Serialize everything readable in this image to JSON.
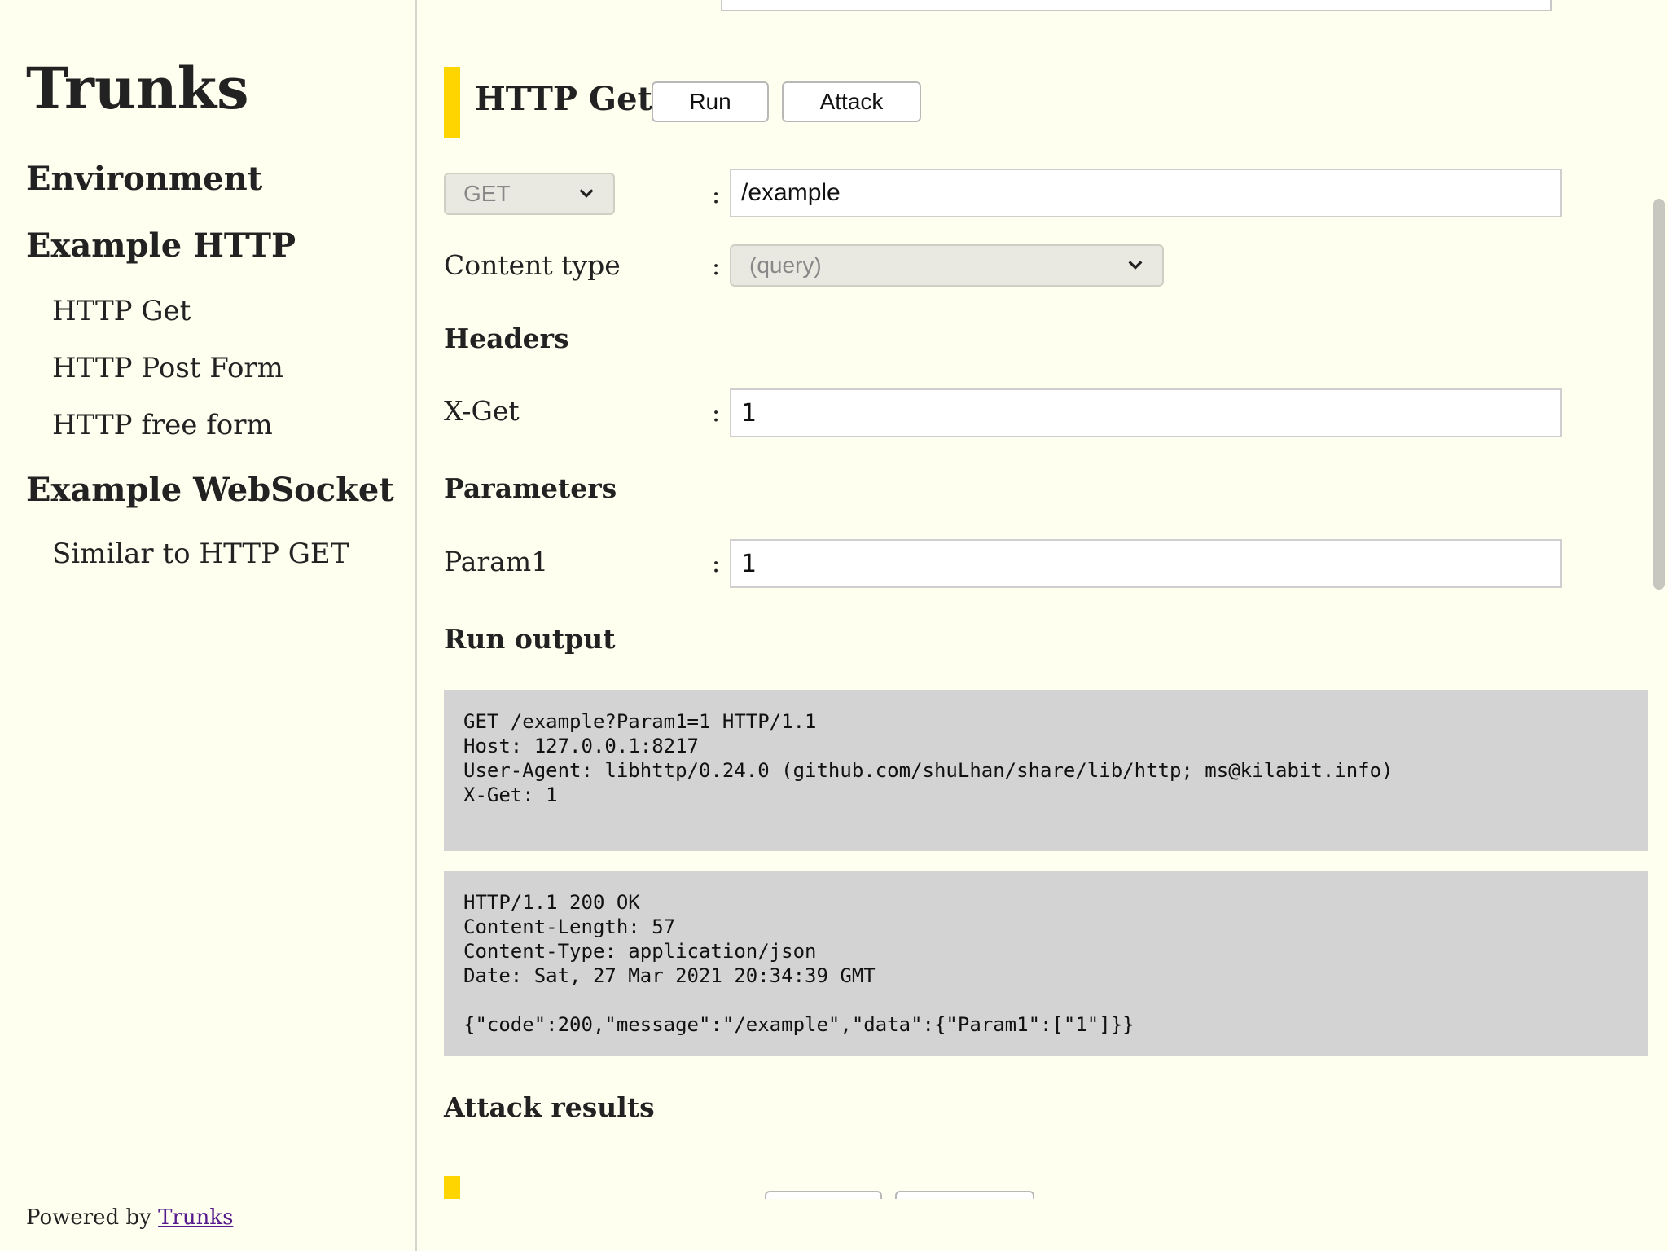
{
  "sidebar": {
    "brand": "Trunks",
    "environment": "Environment",
    "group_http": "Example HTTP",
    "http_items": [
      "HTTP Get",
      "HTTP Post Form",
      "HTTP free form"
    ],
    "group_ws": "Example WebSocket",
    "ws_items": [
      "Similar to HTTP GET"
    ]
  },
  "footer": {
    "prefix": "Powered by ",
    "link": "Trunks"
  },
  "request": {
    "title": "HTTP Get",
    "run_label": "Run",
    "attack_label": "Attack",
    "method": "GET",
    "path": "/example",
    "content_type_label": "Content type",
    "content_type_value": "(query)",
    "colon": ":"
  },
  "headers": {
    "heading": "Headers",
    "items": [
      {
        "key": "X-Get",
        "value": "1"
      }
    ]
  },
  "parameters": {
    "heading": "Parameters",
    "items": [
      {
        "key": "Param1",
        "value": "1"
      }
    ]
  },
  "run_output": {
    "heading": "Run output",
    "request_dump": "GET /example?Param1=1 HTTP/1.1\nHost: 127.0.0.1:8217\nUser-Agent: libhttp/0.24.0 (github.com/shuLhan/share/lib/http; ms@kilabit.info)\nX-Get: 1\n",
    "response_dump": "HTTP/1.1 200 OK\nContent-Length: 57\nContent-Type: application/json\nDate: Sat, 27 Mar 2021 20:34:39 GMT\n\n{\"code\":200,\"message\":\"/example\",\"data\":{\"Param1\":[\"1\"]}}"
  },
  "attack_results": {
    "heading": "Attack results"
  },
  "colors": {
    "background": "#fffff0",
    "accent": "#ffd500",
    "output_bg": "#d3d3d3"
  }
}
